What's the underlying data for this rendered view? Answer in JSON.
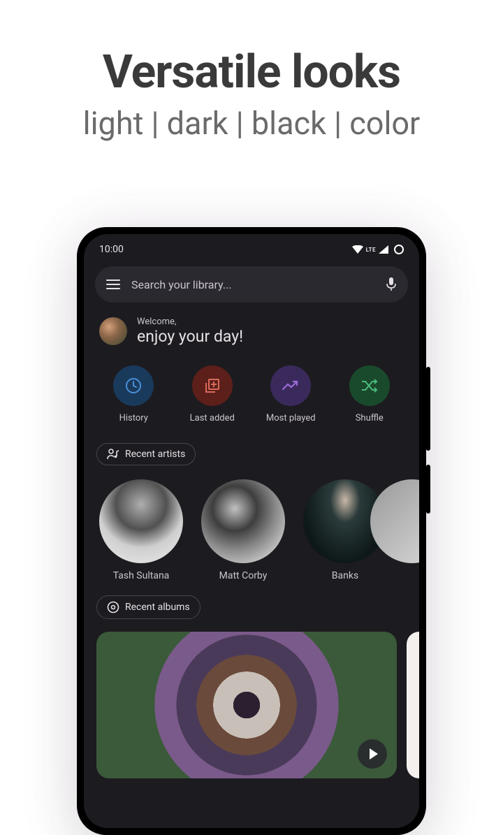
{
  "marketing": {
    "title": "Versatile looks",
    "subtitle": "light | dark | black | color"
  },
  "statusbar": {
    "time": "10:00",
    "lte_label": "LTE"
  },
  "search": {
    "placeholder": "Search your library..."
  },
  "welcome": {
    "small": "Welcome,",
    "big": "enjoy your day!"
  },
  "categories": [
    {
      "label": "History",
      "color": "blue",
      "icon": "clock-icon"
    },
    {
      "label": "Last added",
      "color": "red",
      "icon": "library-add-icon"
    },
    {
      "label": "Most played",
      "color": "purple",
      "icon": "trending-icon"
    },
    {
      "label": "Shuffle",
      "color": "green",
      "icon": "shuffle-icon"
    }
  ],
  "chips": {
    "recent_artists": "Recent artists",
    "recent_albums": "Recent albums"
  },
  "artists": [
    {
      "name": "Tash Sultana"
    },
    {
      "name": "Matt Corby"
    },
    {
      "name": "Banks"
    }
  ]
}
